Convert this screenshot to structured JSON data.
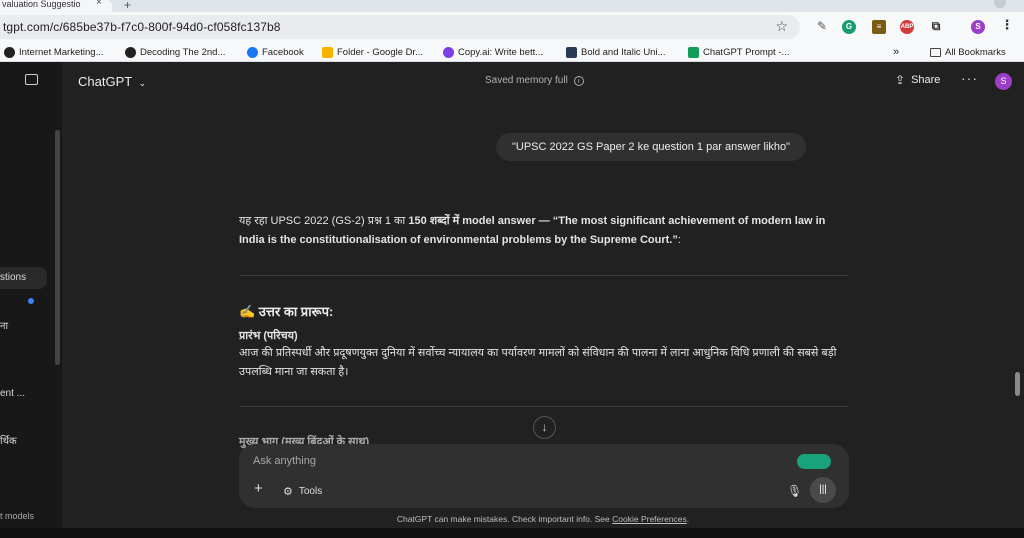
{
  "browser": {
    "tab_title": "valuation Suggestio",
    "url": "tgpt.com/c/685be37b-f7c0-800f-94d0-cf058fc137b8",
    "bookmarks": [
      {
        "label": "Internet Marketing...",
        "icon": "openai-icon"
      },
      {
        "label": "Decoding The 2nd...",
        "icon": "openai-icon"
      },
      {
        "label": "Facebook",
        "icon": "facebook-icon"
      },
      {
        "label": "Folder - Google Dr...",
        "icon": "google-drive-icon"
      },
      {
        "label": "Copy.ai: Write bett...",
        "icon": "copyai-icon"
      },
      {
        "label": "Bold and Italic Uni...",
        "icon": "text-icon"
      },
      {
        "label": "ChatGPT Prompt -...",
        "icon": "sheets-icon"
      }
    ],
    "overflow_label": "»",
    "all_bookmarks_label": "All Bookmarks",
    "profile_initial": "S",
    "ext_abp": "ABP"
  },
  "sidebar": {
    "items": [
      {
        "label": "stions"
      },
      {
        "label": "ना"
      },
      {
        "label": "ent ..."
      },
      {
        "label": "र्थिक"
      },
      {
        "label": "t models"
      }
    ]
  },
  "header": {
    "title": "ChatGPT",
    "memory_status": "Saved memory full",
    "share_label": "Share",
    "avatar_initial": "S"
  },
  "conversation": {
    "user_message": "\"UPSC 2022 GS Paper 2 ke question 1 par answer likho\"",
    "intro_plain": "यह रहा UPSC 2022 (GS-2) प्रश्न 1 का ",
    "intro_bold": "150 शब्दों में model answer — “The most significant achievement of modern law in India is the constitutionalisation of environmental problems by the Supreme Court.”",
    "intro_end": ":",
    "section_heading": "✍️ उत्तर का प्रारूप:",
    "sub1_title": "प्रारंभ (परिचय)",
    "sub1_body": "आज की प्रतिस्पर्धी और प्रदूषणयुक्त दुनिया में सर्वोच्च न्यायालय का पर्यावरण मामलों को संविधान की पालना में लाना आधुनिक विधि प्रणाली की सबसे बड़ी उपलब्धि माना जा सकता है।",
    "sub2_title": "मुख्य भाग (मुख्य बिंदुओं के साथ)"
  },
  "composer": {
    "placeholder": "Ask anything",
    "tools_label": "Tools"
  },
  "footer": {
    "text": "ChatGPT can make mistakes. Check important info. See ",
    "link": "Cookie Preferences",
    "end": "."
  }
}
